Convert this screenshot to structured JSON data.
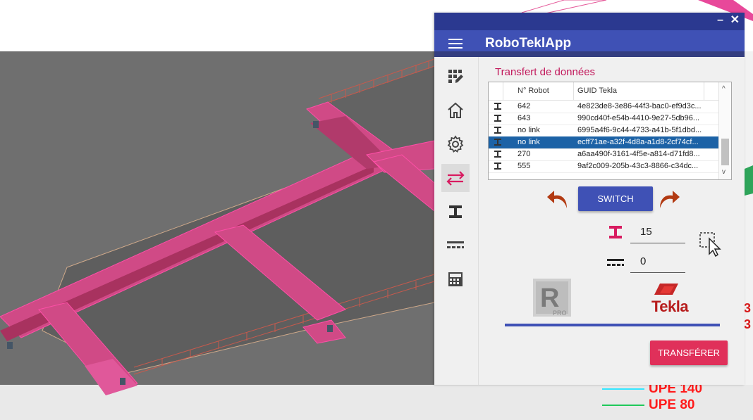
{
  "window": {
    "minimize_icon": "minimize-icon",
    "close_icon": "close-icon"
  },
  "app": {
    "title": "RoboTeklApp",
    "menu_icon": "hamburger-menu-icon"
  },
  "sidebar": {
    "items": [
      {
        "name": "grid-edit-icon",
        "active": false
      },
      {
        "name": "home-icon",
        "active": false
      },
      {
        "name": "settings-gear-icon",
        "active": false
      },
      {
        "name": "transfer-arrows-icon",
        "active": true
      },
      {
        "name": "i-beam-icon",
        "active": false
      },
      {
        "name": "slab-lines-icon",
        "active": false
      },
      {
        "name": "calculator-icon",
        "active": false
      }
    ]
  },
  "transfer": {
    "title": "Transfert de données",
    "columns": [
      "N° Robot",
      "GUID Tekla"
    ],
    "rows": [
      {
        "robot": "642",
        "guid": "4e823de8-3e86-44f3-bac0-ef9d3c...",
        "selected": false
      },
      {
        "robot": "643",
        "guid": "990cd40f-e54b-4410-9e27-5db96...",
        "selected": false
      },
      {
        "robot": "no link",
        "guid": "6995a4f6-9c44-4733-a41b-5f1dbd...",
        "selected": false
      },
      {
        "robot": "no link",
        "guid": "ecff71ae-a32f-4d8a-a1d8-2cf74cf...",
        "selected": true
      },
      {
        "robot": "270",
        "guid": "a6aa490f-3161-4f5e-a814-d71fd8...",
        "selected": false
      },
      {
        "robot": "555",
        "guid": "9af2c009-205b-43c3-8866-c34dc...",
        "selected": false
      }
    ],
    "switch_label": "SWITCH",
    "beam_count": "15",
    "slab_count": "0",
    "robot_logo_text": "R",
    "robot_logo_sub": "PRO",
    "tekla_label": "Tekla",
    "transfer_label": "TRANSFÉRER"
  },
  "legend": [
    {
      "label": "UPE 140",
      "color": "#33e6ff"
    },
    {
      "label": "UPE 80",
      "color": "#1fc95a"
    }
  ],
  "side_labels": [
    "3",
    "3"
  ],
  "colors": {
    "primary": "#3f51b5",
    "titlebar": "#2b3990",
    "accent": "#e0305a",
    "section_title": "#c2185b",
    "selected_row": "#1c62a6"
  }
}
